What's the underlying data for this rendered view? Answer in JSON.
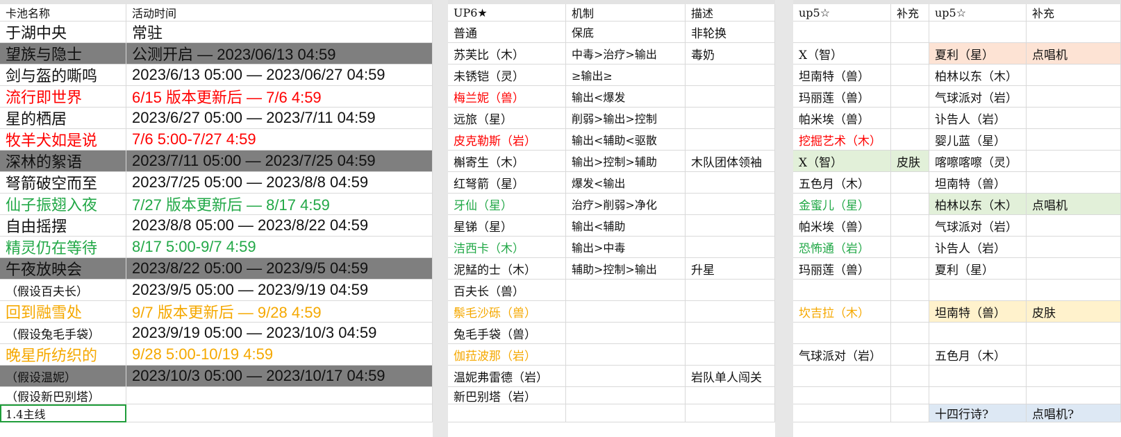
{
  "colors": {
    "gray_fill": "#7f7f7f",
    "red": "#ff0000",
    "green": "#22a847",
    "orange": "#f5a800",
    "peach_fill": "#fde3d4",
    "green_fill": "#e2f0d9",
    "yellow_fill": "#fff2cc",
    "blue_fill": "#dde8f4"
  },
  "left": {
    "headers": {
      "pool": "卡池名称",
      "time": "活动时间"
    },
    "rows": [
      {
        "pool": "于湖中央",
        "time": "常驻",
        "style": "plain"
      },
      {
        "pool": "望族与隐士",
        "time": "公测开启 — 2023/06/13 04:59",
        "style": "gray"
      },
      {
        "pool": "剑与盔的嘶鸣",
        "time": "2023/6/13 05:00 — 2023/06/27 04:59",
        "style": "plain"
      },
      {
        "pool": "流行即世界",
        "time": "6/15 版本更新后 — 7/6 4:59",
        "style": "red"
      },
      {
        "pool": "星的栖居",
        "time": "2023/6/27 05:00 — 2023/7/11 04:59",
        "style": "plain"
      },
      {
        "pool": "牧羊犬如是说",
        "time": "7/6 5:00-7/27 4:59",
        "style": "red"
      },
      {
        "pool": "深林的絮语",
        "time": "2023/7/11 05:00 — 2023/7/25 04:59",
        "style": "gray"
      },
      {
        "pool": "弩箭破空而至",
        "time": "2023/7/25 05:00 — 2023/8/8 04:59",
        "style": "plain"
      },
      {
        "pool": "仙子振翅入夜",
        "time": "7/27 版本更新后 — 8/17 4:59",
        "style": "green"
      },
      {
        "pool": "自由摇摆",
        "time": "2023/8/8 05:00 — 2023/8/22 04:59",
        "style": "plain"
      },
      {
        "pool": "精灵仍在等待",
        "time": "8/17 5:00-9/7 4:59",
        "style": "green"
      },
      {
        "pool": "午夜放映会",
        "time": "2023/8/22 05:00 — 2023/9/5 04:59",
        "style": "gray"
      },
      {
        "pool": "（假设百夫长）",
        "time": "2023/9/5 05:00 — 2023/9/19 04:59",
        "style": "paren"
      },
      {
        "pool": "回到融雪处",
        "time": "9/7 版本更新后 — 9/28 4:59",
        "style": "orange"
      },
      {
        "pool": "（假设兔毛手袋）",
        "time": "2023/9/19 05:00 — 2023/10/3 04:59",
        "style": "paren"
      },
      {
        "pool": "晚星所纺织的",
        "time": "9/28 5:00-10/19 4:59",
        "style": "orange"
      },
      {
        "pool": "（假设温妮）",
        "time": "2023/10/3 05:00 — 2023/10/17 04:59",
        "style": "graparen"
      },
      {
        "pool": "（假设新巴别塔）",
        "time": "",
        "style": "paren"
      },
      {
        "pool": "1.4主线",
        "time": "",
        "style": "selected"
      }
    ]
  },
  "middle": {
    "headers": {
      "up6": "UP6★",
      "mech": "机制",
      "desc": "描述"
    },
    "rows": [
      {
        "up6": "普通",
        "mech": "保底",
        "desc": "非轮换",
        "color": "plain"
      },
      {
        "up6": "苏芙比（木）",
        "mech": "中毒>治疗>输出",
        "desc": "毒奶",
        "color": "plain"
      },
      {
        "up6": "未锈铠（灵）",
        "mech": "≥输出≥",
        "desc": "",
        "color": "plain"
      },
      {
        "up6": "梅兰妮（兽）",
        "mech": "输出<爆发",
        "desc": "",
        "color": "red"
      },
      {
        "up6": "远旅（星）",
        "mech": "削弱>输出>控制",
        "desc": "",
        "color": "plain"
      },
      {
        "up6": "皮克勒斯（岩）",
        "mech": "输出<辅助<驱散",
        "desc": "",
        "color": "red"
      },
      {
        "up6": "槲寄生（木）",
        "mech": "输出>控制>辅助",
        "desc": "木队团体领袖",
        "color": "plain"
      },
      {
        "up6": "红弩箭（星）",
        "mech": "爆发<输出",
        "desc": "",
        "color": "plain"
      },
      {
        "up6": "牙仙（星）",
        "mech": "治疗>削弱>净化",
        "desc": "",
        "color": "green"
      },
      {
        "up6": "星锑（星）",
        "mech": "输出<辅助",
        "desc": "",
        "color": "plain"
      },
      {
        "up6": "洁西卡（木）",
        "mech": "输出>中毒",
        "desc": "",
        "color": "green"
      },
      {
        "up6": "泥鯭的士（木）",
        "mech": "辅助>控制>输出",
        "desc": "升星",
        "color": "plain"
      },
      {
        "up6": "百夫长（兽）",
        "mech": "",
        "desc": "",
        "color": "plain"
      },
      {
        "up6": "鬃毛沙砾（兽）",
        "mech": "",
        "desc": "",
        "color": "orange"
      },
      {
        "up6": "兔毛手袋（兽）",
        "mech": "",
        "desc": "",
        "color": "plain"
      },
      {
        "up6": "伽菈波那（岩）",
        "mech": "",
        "desc": "",
        "color": "orange"
      },
      {
        "up6": "温妮弗雷德（岩）",
        "mech": "",
        "desc": "岩队单人闯关",
        "color": "plain"
      },
      {
        "up6": "新巴别塔（岩）",
        "mech": "",
        "desc": "",
        "color": "plain"
      },
      {
        "up6": "",
        "mech": "",
        "desc": "",
        "color": "plain"
      }
    ]
  },
  "right": {
    "headers": {
      "up5a": "up5☆",
      "suppa": "补充",
      "up5b": "up5☆",
      "suppb": "补充"
    },
    "rows": [
      {
        "up5a": "",
        "suppa": "",
        "up5b": "",
        "suppb": "",
        "ca": "plain",
        "cb": "plain",
        "fa": "",
        "fb": ""
      },
      {
        "up5a": "X（智）",
        "suppa": "",
        "up5b": "夏利（星）",
        "suppb": "点唱机",
        "ca": "plain",
        "cb": "plain",
        "fa": "",
        "fb": "peach"
      },
      {
        "up5a": "坦南特（兽）",
        "suppa": "",
        "up5b": "柏林以东（木）",
        "suppb": "",
        "ca": "plain",
        "cb": "plain",
        "fa": "",
        "fb": ""
      },
      {
        "up5a": "玛丽莲（兽）",
        "suppa": "",
        "up5b": "气球派对（岩）",
        "suppb": "",
        "ca": "plain",
        "cb": "plain",
        "fa": "",
        "fb": ""
      },
      {
        "up5a": "帕米埃（兽）",
        "suppa": "",
        "up5b": "讣告人（岩）",
        "suppb": "",
        "ca": "plain",
        "cb": "plain",
        "fa": "",
        "fb": ""
      },
      {
        "up5a": "挖掘艺术（木）",
        "suppa": "",
        "up5b": "婴儿蓝（星）",
        "suppb": "",
        "ca": "red",
        "cb": "plain",
        "fa": "",
        "fb": ""
      },
      {
        "up5a": "X（智）",
        "suppa": "皮肤",
        "up5b": "喀嚓喀嚓（灵）",
        "suppb": "",
        "ca": "plain",
        "cb": "plain",
        "fa": "green",
        "fb": ""
      },
      {
        "up5a": "五色月（木）",
        "suppa": "",
        "up5b": "坦南特（兽）",
        "suppb": "",
        "ca": "plain",
        "cb": "plain",
        "fa": "",
        "fb": ""
      },
      {
        "up5a": "金蜜儿（星）",
        "suppa": "",
        "up5b": "柏林以东（木）",
        "suppb": "点唱机",
        "ca": "green",
        "cb": "plain",
        "fa": "",
        "fb": "green"
      },
      {
        "up5a": "帕米埃（兽）",
        "suppa": "",
        "up5b": "气球派对（岩）",
        "suppb": "",
        "ca": "plain",
        "cb": "plain",
        "fa": "",
        "fb": ""
      },
      {
        "up5a": "恐怖通（岩）",
        "suppa": "",
        "up5b": "讣告人（岩）",
        "suppb": "",
        "ca": "green",
        "cb": "plain",
        "fa": "",
        "fb": ""
      },
      {
        "up5a": "玛丽莲（兽）",
        "suppa": "",
        "up5b": "夏利（星）",
        "suppb": "",
        "ca": "plain",
        "cb": "plain",
        "fa": "",
        "fb": ""
      },
      {
        "up5a": "",
        "suppa": "",
        "up5b": "",
        "suppb": "",
        "ca": "plain",
        "cb": "plain",
        "fa": "",
        "fb": ""
      },
      {
        "up5a": "坎吉拉（木）",
        "suppa": "",
        "up5b": "坦南特（兽）",
        "suppb": "皮肤",
        "ca": "orange",
        "cb": "plain",
        "fa": "",
        "fb": "yellow"
      },
      {
        "up5a": "",
        "suppa": "",
        "up5b": "",
        "suppb": "",
        "ca": "plain",
        "cb": "plain",
        "fa": "",
        "fb": ""
      },
      {
        "up5a": "气球派对（岩）",
        "suppa": "",
        "up5b": "五色月（木）",
        "suppb": "",
        "ca": "plain",
        "cb": "plain",
        "fa": "",
        "fb": ""
      },
      {
        "up5a": "",
        "suppa": "",
        "up5b": "",
        "suppb": "",
        "ca": "plain",
        "cb": "plain",
        "fa": "",
        "fb": ""
      },
      {
        "up5a": "",
        "suppa": "",
        "up5b": "",
        "suppb": "",
        "ca": "plain",
        "cb": "plain",
        "fa": "",
        "fb": ""
      },
      {
        "up5a": "",
        "suppa": "",
        "up5b": "十四行诗?",
        "suppb": "点唱机?",
        "ca": "plain",
        "cb": "plain",
        "fa": "",
        "fb": "blue"
      }
    ]
  }
}
